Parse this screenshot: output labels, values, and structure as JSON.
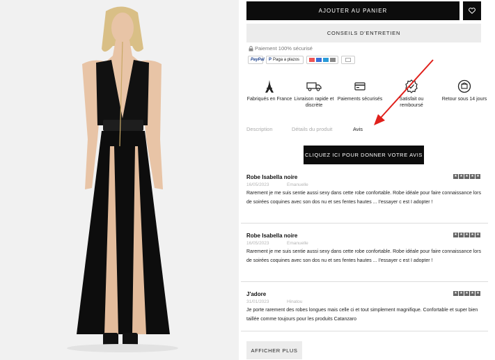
{
  "actions": {
    "add_to_cart": "AJOUTER AU PANIER",
    "care_advice": "CONSEILS D'ENTRETIEN",
    "give_review": "CLIQUEZ ICI POUR DONNER VOTRE AVIS",
    "show_more": "AFFICHER PLUS"
  },
  "payment": {
    "secure_text": "Paiement 100% sécurisé",
    "methods": [
      "PayPal",
      "Paga a plazos",
      "cards",
      "bank"
    ]
  },
  "features": [
    {
      "icon": "eiffel-tower-icon",
      "label": "Fabriqués en France"
    },
    {
      "icon": "delivery-truck-icon",
      "label": "Livraison rapide et discrète"
    },
    {
      "icon": "secure-card-icon",
      "label": "Paiements sécurisés"
    },
    {
      "icon": "satisfaction-badge-icon",
      "label": "Satisfait ou remboursé"
    },
    {
      "icon": "return-box-icon",
      "label": "Retour sous 14 jours"
    }
  ],
  "tabs": [
    {
      "label": "Description",
      "active": false
    },
    {
      "label": "Détails du produit",
      "active": false
    },
    {
      "label": "Avis",
      "active": true
    }
  ],
  "reviews": [
    {
      "title": "Robe Isabella noire",
      "date": "16/05/2023",
      "author": "Emanuelle",
      "body": "Rarement je me suis sentie aussi sexy dans cette robe confortable. Robe idéale pour faire connaissance lors de soirées coquines avec son dos nu et ses fentes hautes ... I'essayer c est I adopter !",
      "stars": 5
    },
    {
      "title": "Robe Isabella noire",
      "date": "16/05/2023",
      "author": "Emanuelle",
      "body": "Rarement je me suis sentie aussi sexy dans cette robe confortable. Robe idéale pour faire connaissance lors de soirées coquines avec son dos nu et ses fentes hautes ... I'essayer c est I adopter !",
      "stars": 5
    },
    {
      "title": "J'adore",
      "date": "31/01/2023",
      "author": "Hinatou",
      "body": "Je porte rarement des robes longues mais celle ci et tout simplement magnifique. Confortable et super bien taillée comme toujours pour les produits Catanzaro",
      "stars": 5
    }
  ],
  "colors": {
    "primary_button": "#0c0c0c",
    "secondary_button": "#ececec",
    "annotation_arrow": "#e0201b"
  }
}
